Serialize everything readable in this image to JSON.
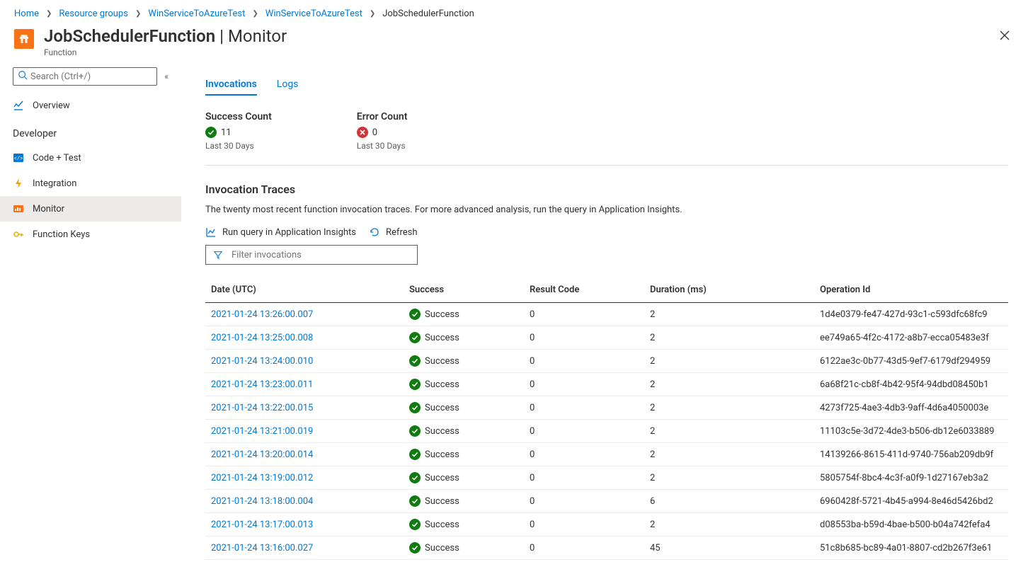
{
  "breadcrumb": {
    "items": [
      {
        "label": "Home"
      },
      {
        "label": "Resource groups"
      },
      {
        "label": "WinServiceToAzureTest"
      },
      {
        "label": "WinServiceToAzureTest"
      },
      {
        "label": "JobSchedulerFunction"
      }
    ]
  },
  "header": {
    "title": "JobSchedulerFunction",
    "section": "Monitor",
    "subtitle": "Function"
  },
  "sidebar": {
    "search_placeholder": "Search (Ctrl+/)",
    "overview_label": "Overview",
    "group_label": "Developer",
    "items": [
      {
        "label": "Code + Test",
        "icon": "code"
      },
      {
        "label": "Integration",
        "icon": "lightning"
      },
      {
        "label": "Monitor",
        "icon": "monitor",
        "active": true
      },
      {
        "label": "Function Keys",
        "icon": "key"
      }
    ]
  },
  "tabs": {
    "invocations": "Invocations",
    "logs": "Logs"
  },
  "metrics": {
    "success": {
      "title": "Success Count",
      "value": "11",
      "sub": "Last 30 Days"
    },
    "error": {
      "title": "Error Count",
      "value": "0",
      "sub": "Last 30 Days"
    }
  },
  "traces": {
    "title": "Invocation Traces",
    "description": "The twenty most recent function invocation traces. For more advanced analysis, run the query in Application Insights.",
    "btn_query": "Run query in Application Insights",
    "btn_refresh": "Refresh",
    "filter_placeholder": "Filter invocations",
    "columns": {
      "date": "Date (UTC)",
      "success": "Success",
      "result": "Result Code",
      "duration": "Duration (ms)",
      "op": "Operation Id"
    },
    "success_label": "Success",
    "rows": [
      {
        "date": "2021-01-24 13:26:00.007",
        "result": "0",
        "duration": "2",
        "op": "1d4e0379-fe47-427d-93c1-c593dfc68fc9"
      },
      {
        "date": "2021-01-24 13:25:00.008",
        "result": "0",
        "duration": "2",
        "op": "ee749a65-4f2c-4172-a8b7-ecca05483e3f"
      },
      {
        "date": "2021-01-24 13:24:00.010",
        "result": "0",
        "duration": "2",
        "op": "6122ae3c-0b77-43d5-9ef7-6179df294959"
      },
      {
        "date": "2021-01-24 13:23:00.011",
        "result": "0",
        "duration": "2",
        "op": "6a68f21c-cb8f-4b42-95f4-94dbd08450b1"
      },
      {
        "date": "2021-01-24 13:22:00.015",
        "result": "0",
        "duration": "2",
        "op": "4273f725-4ae3-4db3-9aff-4d6a4050003e"
      },
      {
        "date": "2021-01-24 13:21:00.019",
        "result": "0",
        "duration": "2",
        "op": "11103c5e-3d72-4de3-b506-db12e6033889"
      },
      {
        "date": "2021-01-24 13:20:00.014",
        "result": "0",
        "duration": "2",
        "op": "14139266-8615-411d-9740-756ab209db9f"
      },
      {
        "date": "2021-01-24 13:19:00.012",
        "result": "0",
        "duration": "2",
        "op": "5805754f-8bc4-4c3f-a0f9-1d27167eb3a2"
      },
      {
        "date": "2021-01-24 13:18:00.004",
        "result": "0",
        "duration": "6",
        "op": "6960428f-5721-4b45-a994-8e46d5426bd2"
      },
      {
        "date": "2021-01-24 13:17:00.013",
        "result": "0",
        "duration": "2",
        "op": "d08553ba-b59d-4bae-b500-b04a742fefa4"
      },
      {
        "date": "2021-01-24 13:16:00.027",
        "result": "0",
        "duration": "45",
        "op": "51c8b685-bc89-4a01-8807-cd2b267f3e61"
      }
    ]
  }
}
